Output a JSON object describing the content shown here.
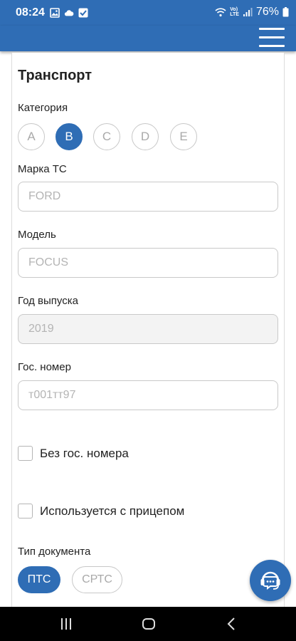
{
  "status_bar": {
    "time": "08:24",
    "battery": "76%",
    "network_top": "Vo)",
    "network_bottom": "LTE"
  },
  "section": {
    "title": "Транспорт"
  },
  "category": {
    "label": "Категория",
    "options": [
      "A",
      "B",
      "C",
      "D",
      "E"
    ],
    "selected": "B"
  },
  "brand": {
    "label": "Марка ТС",
    "placeholder": "FORD"
  },
  "model": {
    "label": "Модель",
    "placeholder": "FOCUS"
  },
  "year": {
    "label": "Год выпуска",
    "placeholder": "2019"
  },
  "plate": {
    "label": "Гос. номер",
    "placeholder": "т001тт97"
  },
  "no_plate": {
    "label": "Без гос. номера",
    "checked": false
  },
  "trailer": {
    "label": "Используется с прицепом",
    "checked": false
  },
  "doc_type": {
    "label": "Тип документа",
    "options": [
      "ПТС",
      "СРТС"
    ],
    "selected": "ПТС"
  },
  "colors": {
    "primary": "#2f6db5",
    "border": "#c9c9c9",
    "placeholder": "#b4b4b4"
  }
}
